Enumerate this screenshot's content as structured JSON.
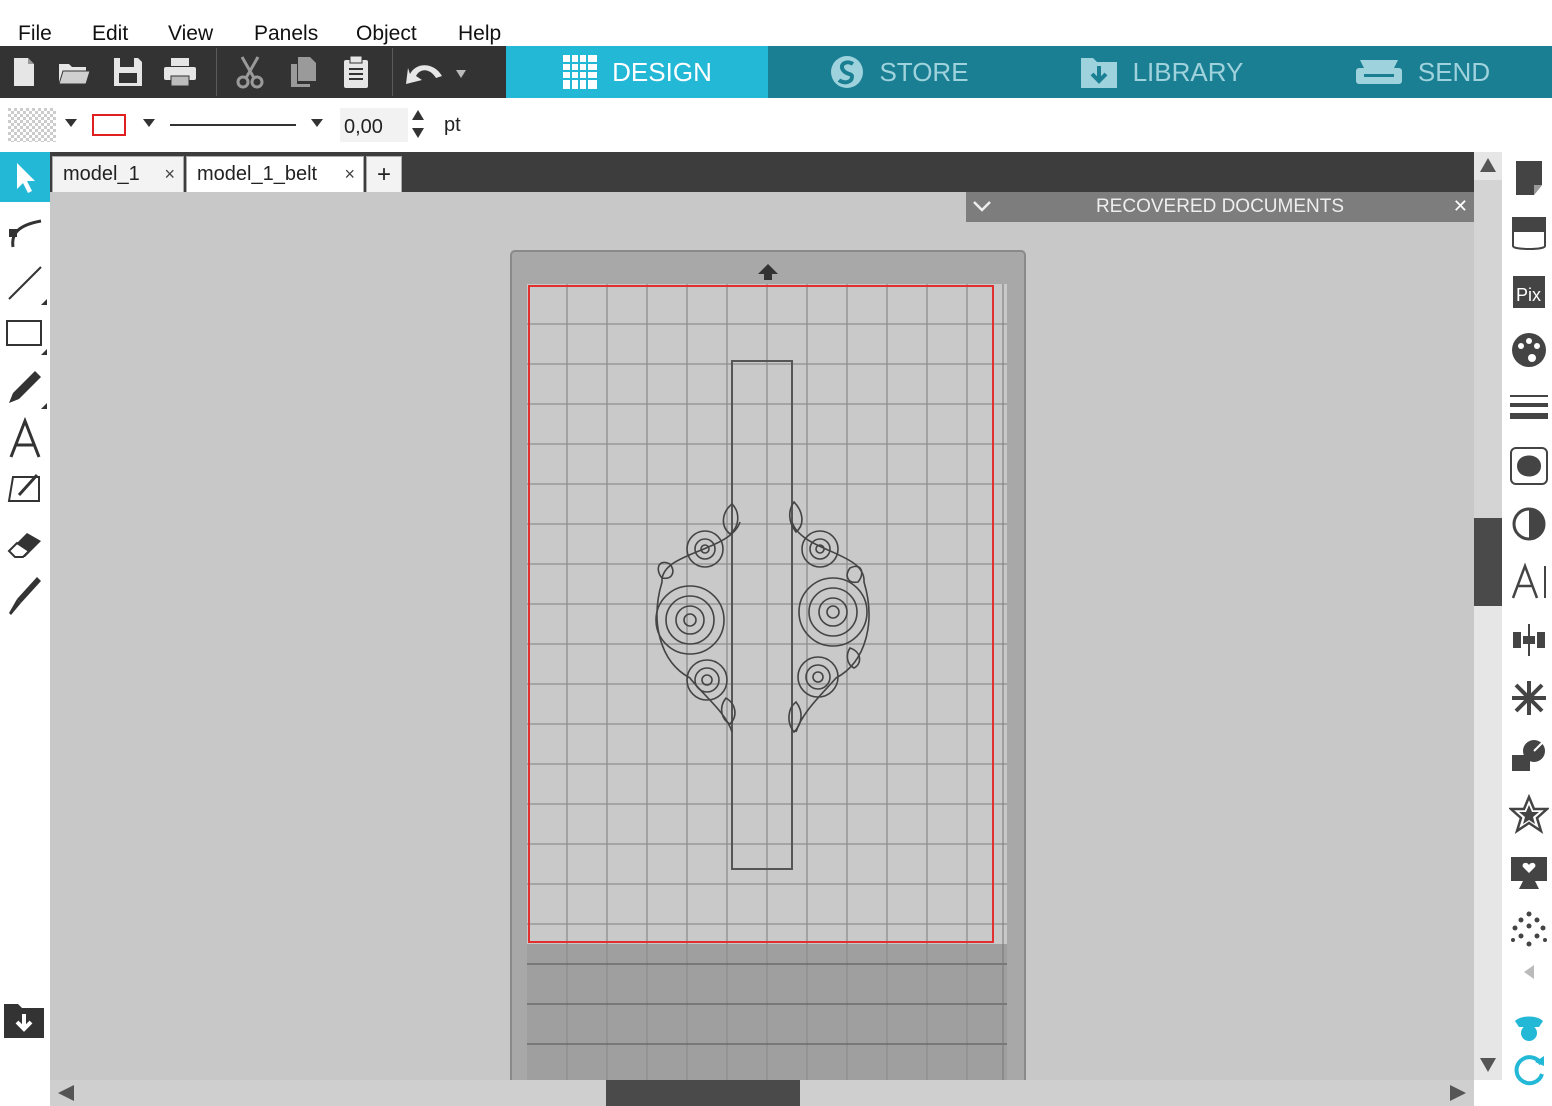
{
  "menu": {
    "items": [
      "File",
      "Edit",
      "View",
      "Panels",
      "Object",
      "Help"
    ]
  },
  "toolbar": {
    "icons": [
      "new-document-icon",
      "open-folder-icon",
      "save-icon",
      "print-icon",
      "cut-icon",
      "copy-icon",
      "paste-icon",
      "undo-icon"
    ]
  },
  "nav": {
    "design": "DESIGN",
    "store": "STORE",
    "library": "LIBRARY",
    "send": "SEND",
    "active_color": "#22b8d6",
    "inactive_color": "#1b7f94"
  },
  "props": {
    "line_width_value": "0,00",
    "line_width_unit": "pt",
    "line_color": "#e02020"
  },
  "tabs": [
    {
      "label": "model_1",
      "close": "×"
    },
    {
      "label": "model_1_belt",
      "close": "×"
    }
  ],
  "tab_add": "+",
  "recovered": {
    "title": "RECOVERED DOCUMENTS",
    "close": "✕"
  },
  "left_tools": [
    "select-tool-icon",
    "edit-points-icon",
    "line-tool-icon",
    "rectangle-tool-icon",
    "pencil-tool-icon",
    "text-tool-icon",
    "sketch-tool-icon",
    "eraser-tool-icon",
    "knife-tool-icon"
  ],
  "right_panel": [
    "page-setup-icon",
    "send-panel-icon",
    "pixscan-icon",
    "fill-panel-icon",
    "line-style-icon",
    "trace-icon",
    "offset-icon",
    "text-style-icon",
    "align-icon",
    "replicate-icon",
    "transform-icon",
    "favorites-icon",
    "design-store-icon",
    "rhinestone-icon",
    "collapse-arrow-icon",
    "user-icon",
    "sync-icon"
  ]
}
